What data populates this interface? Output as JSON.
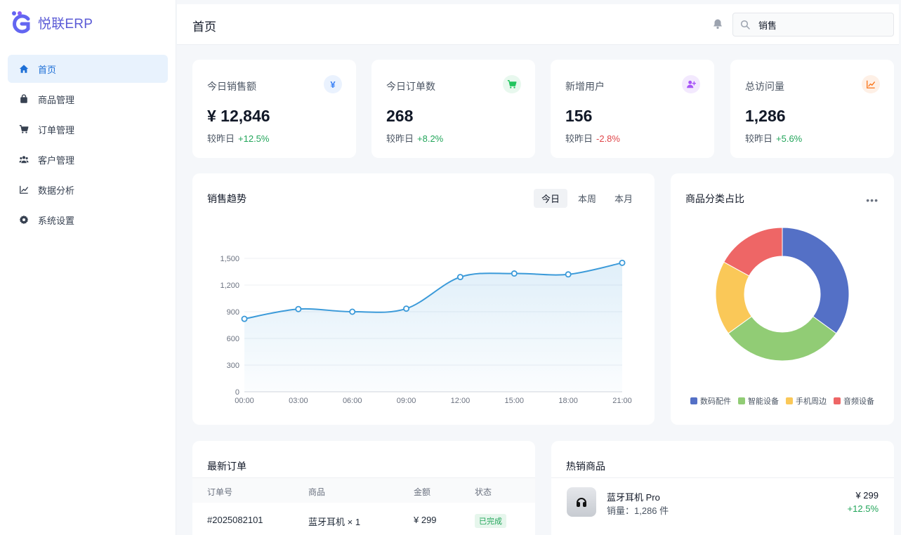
{
  "brand": {
    "name": "悦联ERP"
  },
  "sidebar": {
    "items": [
      {
        "label": "首页",
        "icon": "home-icon",
        "active": true
      },
      {
        "label": "商品管理",
        "icon": "bag-icon"
      },
      {
        "label": "订单管理",
        "icon": "cart-icon"
      },
      {
        "label": "客户管理",
        "icon": "users-icon"
      },
      {
        "label": "数据分析",
        "icon": "chart-line-icon"
      },
      {
        "label": "系统设置",
        "icon": "gear-icon"
      }
    ]
  },
  "header": {
    "title": "首页",
    "search": {
      "value": "销售",
      "placeholder": ""
    }
  },
  "stats": [
    {
      "label": "今日销售额",
      "value": "¥ 12,846",
      "compare_label": "较昨日",
      "change": "+12.5%",
      "trend": "up",
      "icon": "yen-icon",
      "icon_glyph": "¥",
      "icon_color": "#3b82f6",
      "icon_bg": "#eaf2fe"
    },
    {
      "label": "今日订单数",
      "value": "268",
      "compare_label": "较昨日",
      "change": "+8.2%",
      "trend": "up",
      "icon": "cart-icon",
      "icon_color": "#22c55e",
      "icon_bg": "#e8f8ee"
    },
    {
      "label": "新增用户",
      "value": "156",
      "compare_label": "较昨日",
      "change": "-2.8%",
      "trend": "down",
      "icon": "user-plus-icon",
      "icon_color": "#a855f7",
      "icon_bg": "#f3e9fe"
    },
    {
      "label": "总访问量",
      "value": "1,286",
      "compare_label": "较昨日",
      "change": "+5.6%",
      "trend": "up",
      "icon": "chart-line-icon",
      "icon_color": "#f97316",
      "icon_bg": "#fef0e6"
    }
  ],
  "sales_trend": {
    "title": "销售趋势",
    "ranges": [
      "今日",
      "本周",
      "本月"
    ],
    "selected_range": "今日"
  },
  "category_share": {
    "title": "商品分类占比"
  },
  "recent_orders": {
    "title": "最新订单",
    "columns": [
      "订单号",
      "商品",
      "金额",
      "状态"
    ],
    "rows": [
      {
        "id": "#2025082101",
        "product": "蓝牙耳机 × 1",
        "amount": "¥ 299",
        "status": "已完成"
      }
    ]
  },
  "hot_products": {
    "title": "热销商品",
    "items": [
      {
        "name": "蓝牙耳机 Pro",
        "sales": "销量：1,286 件",
        "price": "¥ 299",
        "growth": "+12.5%"
      }
    ]
  },
  "chart_data": [
    {
      "type": "area",
      "x": [
        "00:00",
        "03:00",
        "06:00",
        "09:00",
        "12:00",
        "15:00",
        "18:00",
        "21:00"
      ],
      "series": [
        {
          "values": [
            820,
            930,
            900,
            935,
            1290,
            1330,
            1320,
            1450
          ]
        }
      ],
      "ylim": [
        0,
        1500
      ],
      "yticks": [
        "0",
        "300",
        "600",
        "900",
        "1,200",
        "1,500"
      ],
      "grid": true,
      "color": "#3b9ad9"
    },
    {
      "type": "pie",
      "donut": true,
      "categories": [
        "数码配件",
        "智能设备",
        "手机周边",
        "音频设备"
      ],
      "values": [
        35,
        30,
        18,
        17
      ],
      "colors": [
        "#5470c6",
        "#91cc75",
        "#fac858",
        "#ee6666"
      ],
      "legend": "bottom"
    }
  ]
}
